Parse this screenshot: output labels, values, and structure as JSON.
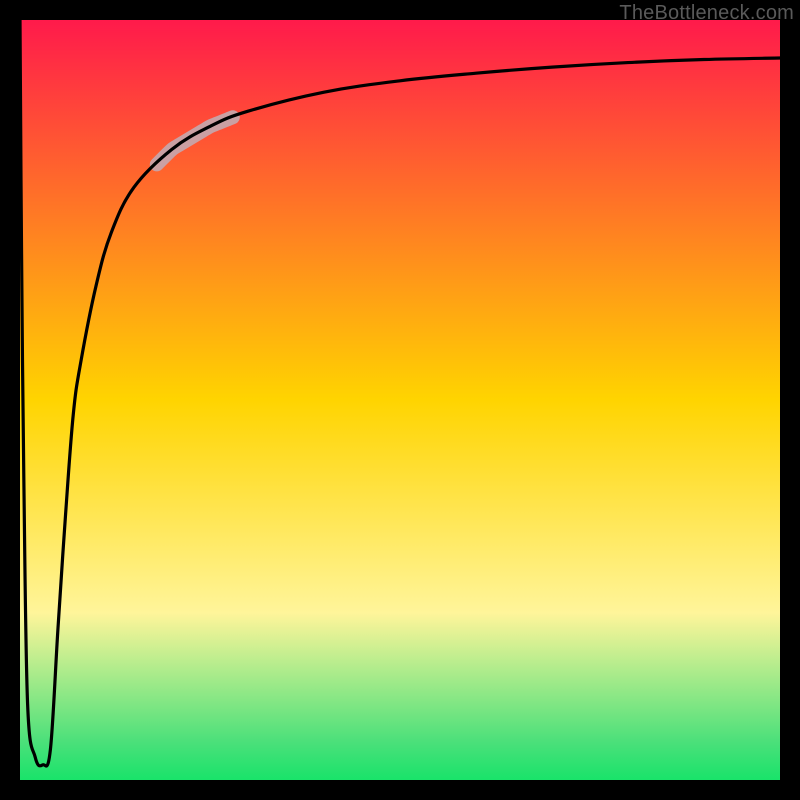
{
  "attribution": "TheBottleneck.com",
  "chart_data": {
    "type": "line",
    "title": "",
    "xlabel": "",
    "ylabel": "",
    "xlim": [
      0,
      100
    ],
    "ylim": [
      0,
      100
    ],
    "x": [
      0,
      0.2,
      0.5,
      1,
      2,
      3,
      4,
      5,
      6,
      7,
      8,
      10,
      12,
      15,
      20,
      25,
      30,
      40,
      50,
      60,
      70,
      80,
      90,
      100
    ],
    "values": [
      100,
      70,
      40,
      10,
      3,
      2,
      4,
      20,
      35,
      48,
      55,
      65,
      72,
      78,
      83,
      86,
      88,
      90.5,
      92,
      93,
      93.8,
      94.4,
      94.8,
      95
    ],
    "highlight_range_x": [
      18,
      28
    ],
    "gradient_stops": [
      {
        "offset": 0.0,
        "color": "#ff1a4b"
      },
      {
        "offset": 0.5,
        "color": "#ffd400"
      },
      {
        "offset": 0.78,
        "color": "#fff59a"
      },
      {
        "offset": 0.95,
        "color": "#4be07a"
      },
      {
        "offset": 1.0,
        "color": "#19e36a"
      }
    ]
  }
}
